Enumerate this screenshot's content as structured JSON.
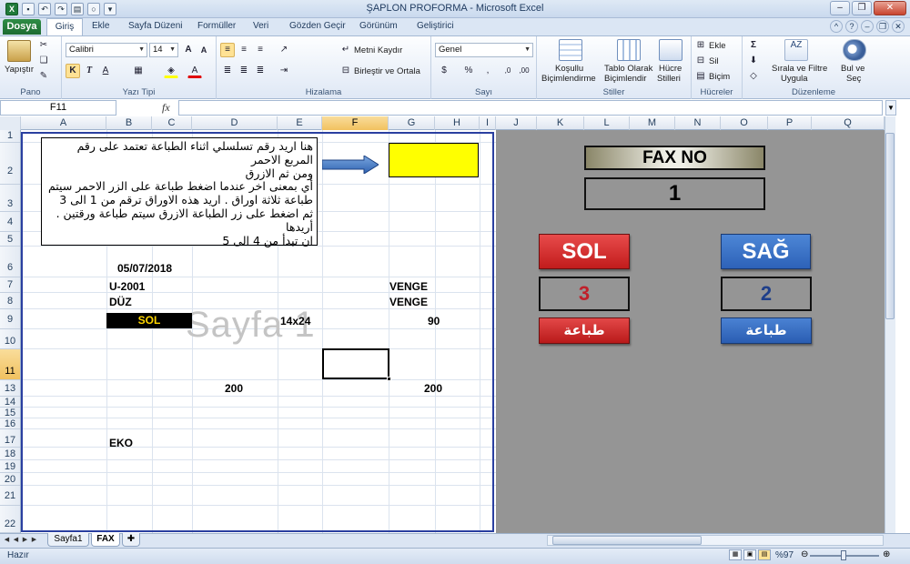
{
  "window": {
    "title": "ŞAPLON PROFORMA  -  Microsoft Excel"
  },
  "ribbon_tabs": {
    "file": "Dosya",
    "home": "Giriş",
    "insert": "Ekle",
    "layout": "Sayfa Düzeni",
    "formulas": "Formüller",
    "data": "Veri",
    "review": "Gözden Geçir",
    "view": "Görünüm",
    "developer": "Geliştirici"
  },
  "ribbon": {
    "paste": "Yapıştır",
    "group_clipboard": "Pano",
    "font_name": "Calibri",
    "font_size": "14",
    "group_font": "Yazı Tipi",
    "wrap_text": "Metni Kaydır",
    "merge_center": "Birleştir ve Ortala",
    "group_alignment": "Hizalama",
    "number_format": "Genel",
    "group_number": "Sayı",
    "conditional_fmt_1": "Koşullu",
    "conditional_fmt_2": "Biçimlendirme",
    "format_table_1": "Tablo Olarak",
    "format_table_2": "Biçimlendir",
    "cell_styles_1": "Hücre",
    "cell_styles_2": "Stilleri",
    "group_styles": "Stiller",
    "insert": "Ekle",
    "delete": "Sil",
    "format": "Biçim",
    "group_cells": "Hücreler",
    "sort_filter_1": "Sırala ve Filtre",
    "sort_filter_2": "Uygula",
    "find_select_1": "Bul ve",
    "find_select_2": "Seç",
    "group_editing": "Düzenleme"
  },
  "formula_bar": {
    "name_box": "F11",
    "fx": "fx",
    "formula": ""
  },
  "columns": [
    "A",
    "B",
    "C",
    "D",
    "E",
    "F",
    "G",
    "H",
    "I",
    "J",
    "K",
    "L",
    "M",
    "N",
    "O",
    "P",
    "Q"
  ],
  "rows": [
    "1",
    "2",
    "3",
    "4",
    "5",
    "6",
    "7",
    "8",
    "9",
    "10",
    "11",
    "13",
    "14",
    "15",
    "16",
    "17",
    "18",
    "19",
    "20",
    "21",
    "22"
  ],
  "note": {
    "line1": "هنا اريد رقم تسلسلي اثناء الطباعة تعتمد على رقم المربع الاحمر",
    "line2": "ومن ثم الازرق",
    "line3": "أي بمعنى اخر عندما اضغط طباعة على الزر الاحمر سيتم",
    "line4": "طباعة ثلاثة اوراق . اريد هذه الاوراق ترقم من 1 الى 3",
    "line5": "ثم اضغط على زر الطباعة الازرق سيتم طباعة ورقتين . أريدها",
    "line6": "ان تبدأ من 4 الى 5"
  },
  "cells": {
    "date": "05/07/2018",
    "code": "U-2001",
    "duz": "DÜZ",
    "venge1": "VENGE",
    "venge2": "VENGE",
    "sol": "SOL",
    "size": "14x24",
    "qty90": "90",
    "v200a": "200",
    "v200b": "200",
    "eko": "EKO"
  },
  "watermark": "Sayfa 1",
  "panel": {
    "fax_label": "FAX NO",
    "fax_no": "1",
    "sol_button": "SOL",
    "sag_button": "SAĞ",
    "sol_count": "3",
    "sag_count": "2",
    "print_label_red": "طباعة",
    "print_label_blue": "طباعة"
  },
  "sheets": {
    "sheet1": "Sayfa1",
    "sheet2": "FAX"
  },
  "status": {
    "ready": "Hazır",
    "zoom": "%97"
  }
}
